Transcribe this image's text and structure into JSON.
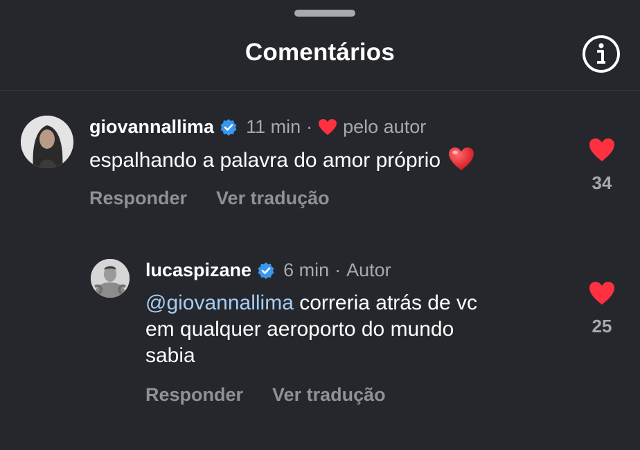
{
  "header": {
    "title": "Comentários",
    "info_icon": "info-icon"
  },
  "comments": [
    {
      "username": "giovannallima",
      "verified": true,
      "time": "11 min",
      "separator": "·",
      "liked_by_author_label": "pelo autor",
      "text": "espalhando a palavra do amor próprio",
      "emoji": "red-heart-emoji",
      "reply_label": "Responder",
      "translate_label": "Ver tradução",
      "likes": "34",
      "liked": true
    },
    {
      "username": "lucaspizane",
      "verified": true,
      "time": "6 min",
      "separator": "·",
      "author_badge": "Autor",
      "mention": "@giovannallima",
      "text_line1": " correria atrás de vc",
      "text_line2": "em qualquer aeroporto do mundo",
      "text_line3": "sabia",
      "reply_label": "Responder",
      "translate_label": "Ver tradução",
      "likes": "25",
      "liked": true
    }
  ],
  "colors": {
    "background": "#25272c",
    "like_red": "#ff3040",
    "verified_blue": "#3897f0",
    "mention": "#a5cdf5",
    "muted": "#a8a9ad"
  }
}
